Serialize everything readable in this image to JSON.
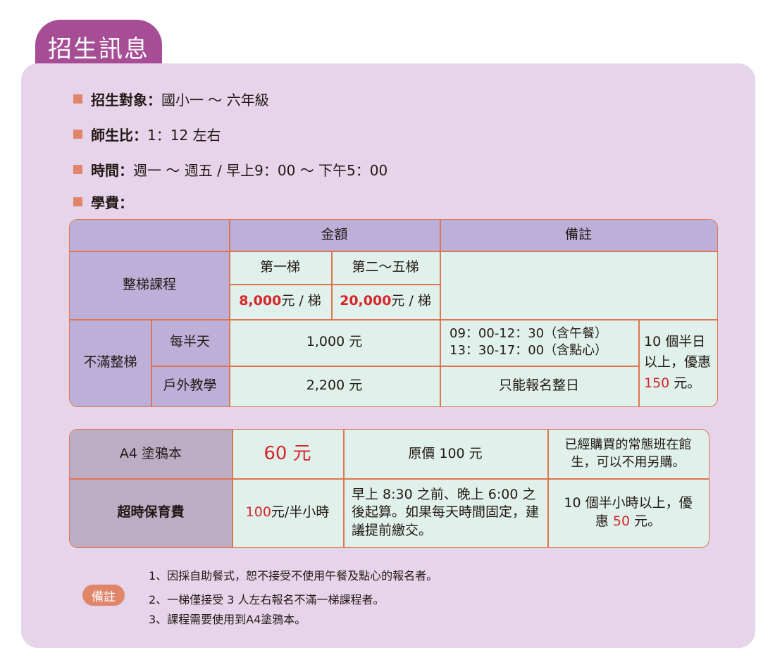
{
  "title": "招生訊息",
  "info": [
    {
      "label": "招生對象：",
      "value": "國小一 ～ 六年級"
    },
    {
      "label": "師生比：",
      "value": "1：12 左右"
    },
    {
      "label": "時間：",
      "value": "週一 ～ 週五 / 早上9：00 ～ 下午5：00"
    },
    {
      "label": "學費：",
      "value": ""
    }
  ],
  "table1": {
    "h_amount": "金額",
    "h_note": "備註",
    "full_course": "整梯課程",
    "tier1": "第一梯",
    "tier2": "第二～五梯",
    "price1_num": "8,000",
    "price1_unit": " 元 / 梯",
    "price2_num": "20,000",
    "price2_unit": " 元 / 梯",
    "partial": "不滿整梯",
    "half_day": "每半天",
    "half_day_price": "1,000 元",
    "half_day_time1": "09：00-12：30（含午餐）",
    "half_day_time2": "13：30-17：00（含點心）",
    "outdoor": "戶外教學",
    "outdoor_price": "2,200 元",
    "outdoor_note": "只能報名整日",
    "discount_pre": "10 個半日以上，優惠 ",
    "discount_num": "150",
    "discount_post": " 元。"
  },
  "table2": {
    "a4_label": "A4 塗鴉本",
    "a4_price": "60 元",
    "a4_original": "原價 100 元",
    "a4_note": "已經購買的常態班在館生，可以不用另購。",
    "over_label": "超時保育費",
    "over_price_num": "100",
    "over_price_unit": "元/半小時",
    "over_desc": "早上 8:30 之前、晚上 6:00 之後起算。如果每天時間固定，建議提前繳交。",
    "over_note_pre": "10 個半小時以上，優惠 ",
    "over_note_num": "50",
    "over_note_post": " 元。"
  },
  "notes": {
    "badge": "備註",
    "lines": [
      "1、因採自助餐式，恕不接受不使用午餐及點心的報名者。",
      "2、一梯僅接受 3 人左右報名不滿一梯課程者。",
      "3、課程需要使用到A4塗鴉本。"
    ]
  }
}
